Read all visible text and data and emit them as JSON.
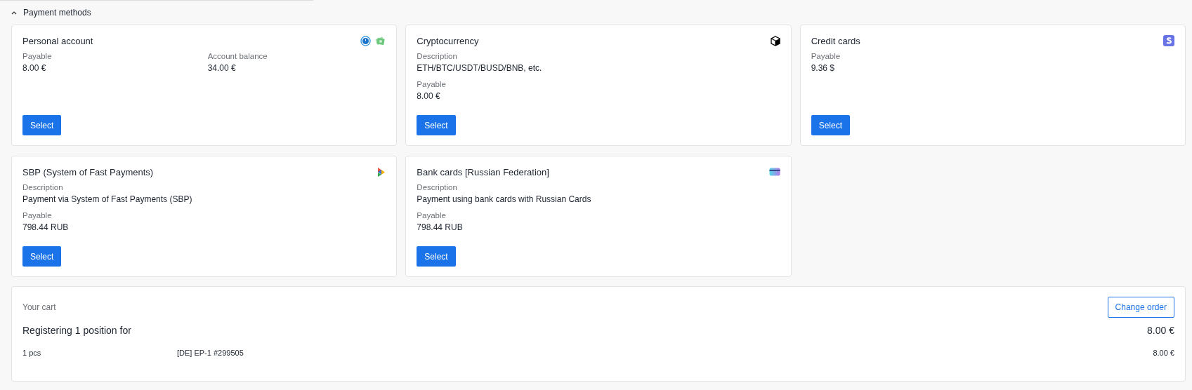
{
  "section": {
    "title": "Payment methods",
    "expanded": true
  },
  "methods": [
    {
      "title": "Personal account",
      "kind": "columns",
      "fields": [
        {
          "label": "Payable",
          "value": "8.00 €"
        },
        {
          "label": "Account balance",
          "value": "34.00 €"
        }
      ],
      "button": "Select"
    },
    {
      "title": "Cryptocurrency",
      "kind": "stack",
      "fields": [
        {
          "label": "Description",
          "value": "ETH/BTC/USDT/BUSD/BNB, etc."
        },
        {
          "label": "Payable",
          "value": "8.00 €"
        }
      ],
      "button": "Select"
    },
    {
      "title": "Credit cards",
      "kind": "stack",
      "fields": [
        {
          "label": "Payable",
          "value": "9.36 $"
        }
      ],
      "button": "Select"
    },
    {
      "title": "SBP (System of Fast Payments)",
      "kind": "stack",
      "fields": [
        {
          "label": "Description",
          "value": "Payment via System of Fast Payments (SBP)"
        },
        {
          "label": "Payable",
          "value": "798.44 RUB"
        }
      ],
      "button": "Select"
    },
    {
      "title": "Bank cards [Russian Federation]",
      "kind": "stack",
      "fields": [
        {
          "label": "Description",
          "value": "Payment using bank cards with Russian Cards"
        },
        {
          "label": "Payable",
          "value": "798.44 RUB"
        }
      ],
      "button": "Select"
    }
  ],
  "cart": {
    "label": "Your cart",
    "button": "Change order",
    "summary": "Registering 1 position for",
    "total": "8.00 €",
    "rows": [
      {
        "quantity": "1 pcs",
        "item": "[DE] EP-1 #299505",
        "price": "8.00 €"
      }
    ]
  }
}
